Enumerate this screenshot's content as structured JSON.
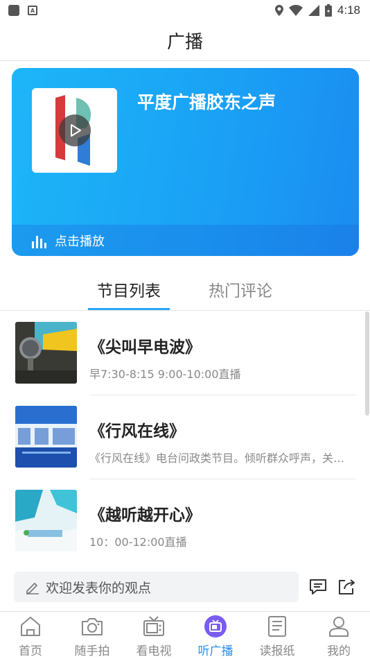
{
  "status_bar": {
    "time": "4:18"
  },
  "header": {
    "title": "广播"
  },
  "hero": {
    "title": "平度广播胶东之声",
    "play_label": "点击播放",
    "accent": "#1aa0f5"
  },
  "tabs": [
    {
      "label": "节目列表",
      "active": true
    },
    {
      "label": "热门评论",
      "active": false
    }
  ],
  "programs": [
    {
      "title": "《尖叫早电波》",
      "desc": "早7:30-8:15 9:00-10:00直播",
      "thumb_icon": "microphone-thumb"
    },
    {
      "title": "《行风在线》",
      "desc": "《行风在线》电台问政类节目。倾听群众呼声，关注民生热点",
      "thumb_icon": "blue-banner-thumb"
    },
    {
      "title": "《越听越开心》",
      "desc": "10：00-12:00直播",
      "thumb_icon": "sky-banner-thumb"
    }
  ],
  "comment": {
    "placeholder": "欢迎发表你的观点"
  },
  "bottom_nav": [
    {
      "label": "首页",
      "icon": "home-icon",
      "active": false
    },
    {
      "label": "随手拍",
      "icon": "camera-icon",
      "active": false
    },
    {
      "label": "看电视",
      "icon": "tv-icon",
      "active": false
    },
    {
      "label": "听广播",
      "icon": "radio-icon",
      "active": true
    },
    {
      "label": "读报纸",
      "icon": "newspaper-icon",
      "active": false
    },
    {
      "label": "我的",
      "icon": "user-icon",
      "active": false
    }
  ],
  "colors": {
    "nav_active": "#2a8ff0",
    "nav_inactive": "#888888",
    "tab_underline": "#2aa3f5"
  }
}
